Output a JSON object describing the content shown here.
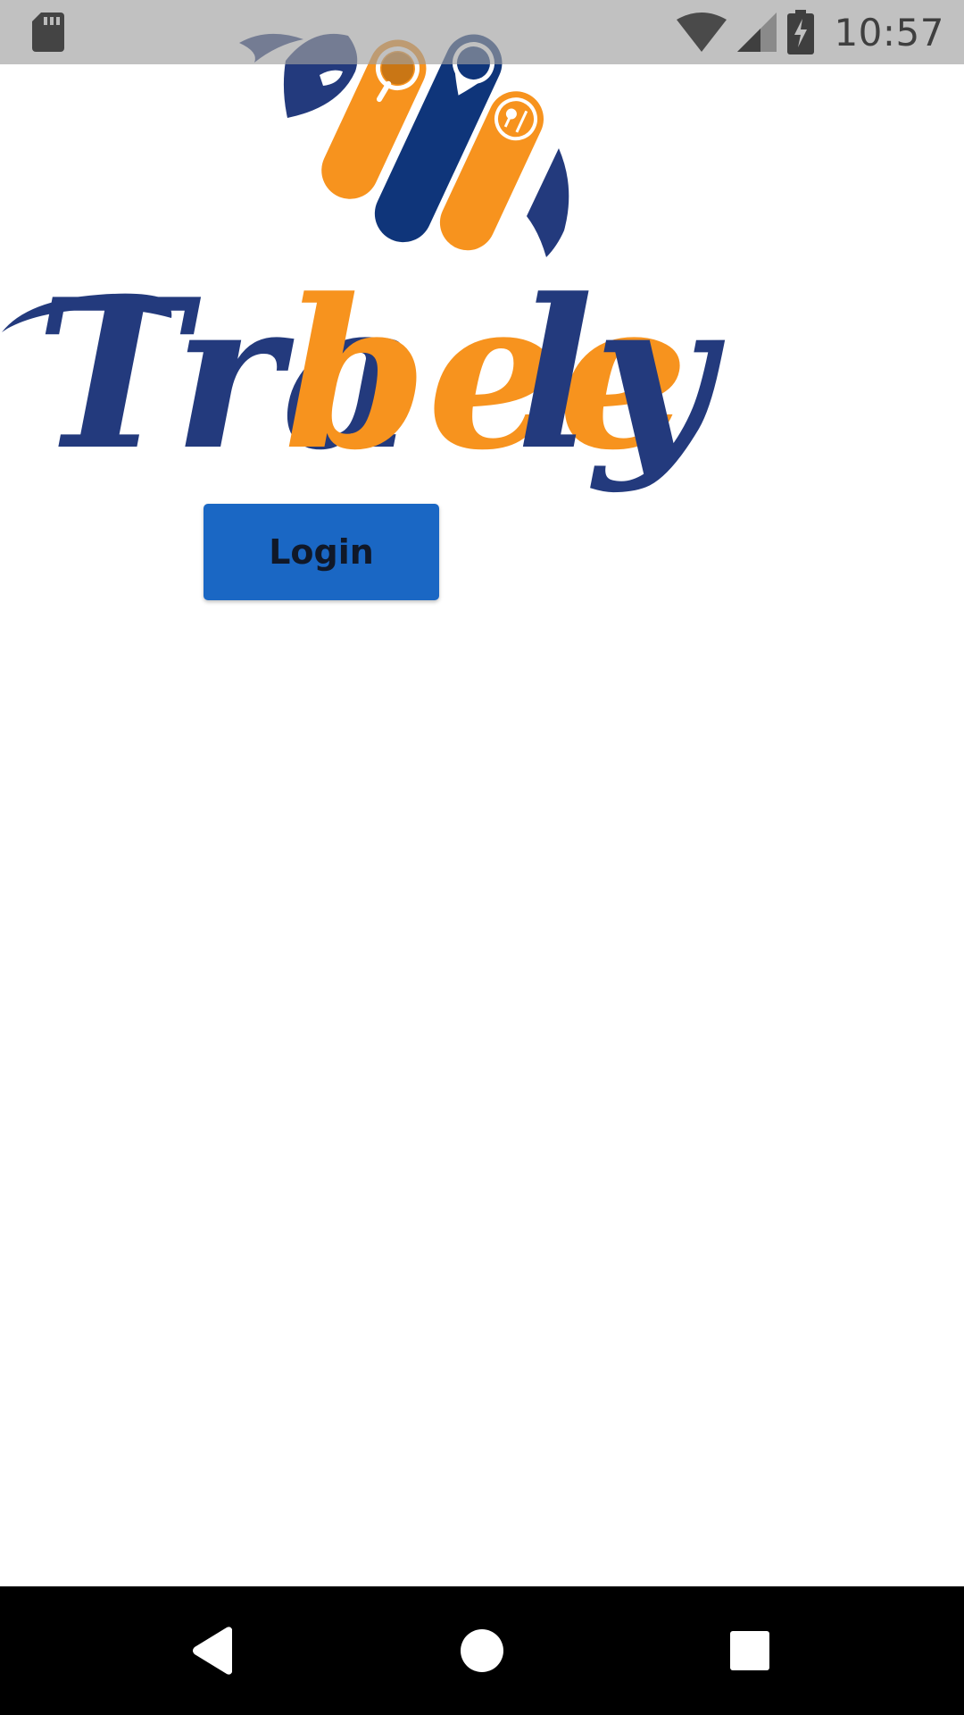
{
  "status_bar": {
    "time": "10:57",
    "icons": [
      "sd-card-icon",
      "wifi-icon",
      "cell-signal-icon",
      "battery-charging-icon"
    ]
  },
  "logo": {
    "brand_name": "Trabeely",
    "colors": {
      "navy": "#233a7d",
      "orange": "#f7931e"
    }
  },
  "login": {
    "label": "Login",
    "color": "#1a67c4"
  },
  "nav_bar": {
    "icons": [
      "back-icon",
      "home-icon",
      "recents-icon"
    ]
  }
}
